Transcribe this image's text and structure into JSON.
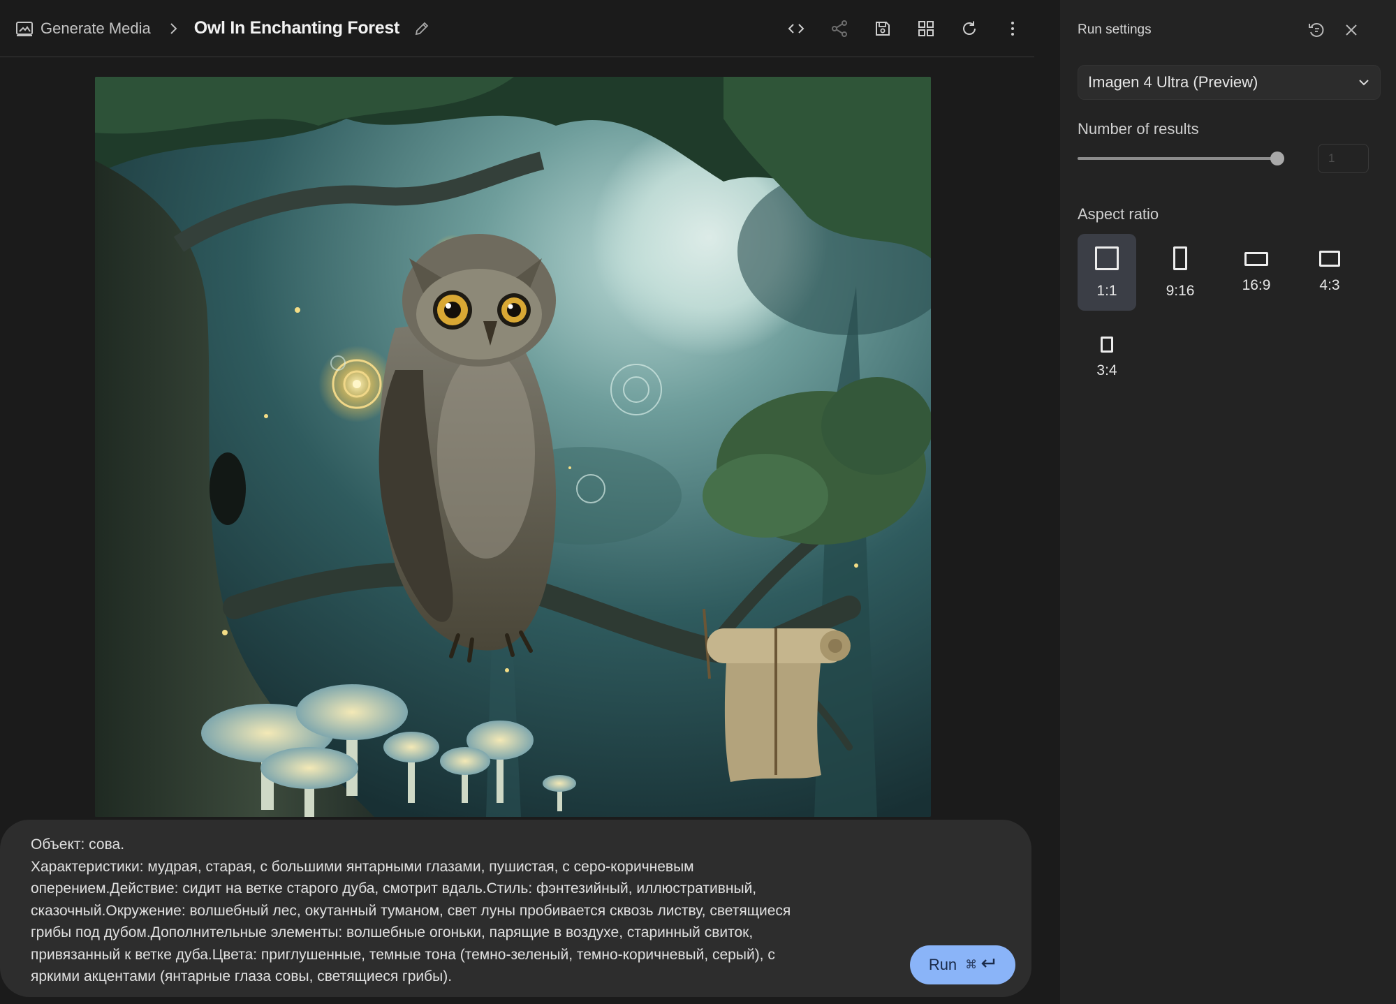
{
  "header": {
    "breadcrumb_parent": "Generate Media",
    "title": "Owl In Enchanting Forest",
    "icons": {
      "parent": "image-icon",
      "separator": "chevron-right-icon",
      "edit": "pencil-icon"
    },
    "toolbar": [
      "code-icon",
      "share-icon",
      "save-icon",
      "grid-icon",
      "refresh-icon",
      "more-vert-icon"
    ]
  },
  "prompt": {
    "text": "Объект: сова.\nХарактеристики: мудрая, старая, с большими янтарными глазами, пушистая, с серо-коричневым\nоперением.Действие: сидит на ветке старого дуба, смотрит вдаль.Стиль: фэнтезийный, иллюстративный,\nсказочный.Окружение: волшебный лес, окутанный туманом, свет луны пробивается сквозь листву, светящиеся\nгрибы под дубом.Дополнительные элементы: волшебные огоньки, парящие в воздухе, старинный свиток,\nпривязанный к ветке дуба.Цвета: приглушенные, темные тона (темно-зеленый, темно-коричневый, серый), с\nяркими акцентами (янтарные глаза совы, светящиеся грибы).",
    "run_label": "Run",
    "run_shortcut_icons": [
      "command-icon",
      "enter-icon"
    ],
    "run_color": "#8ab4f8"
  },
  "run_settings": {
    "title": "Run settings",
    "icons": [
      "reset-icon",
      "close-icon"
    ],
    "model": "Imagen 4 Ultra (Preview)",
    "number_of_results_label": "Number of results",
    "number_of_results_level": 1.0,
    "number_of_results_value": "1",
    "aspect_ratio_label": "Aspect ratio",
    "aspect_ratios": [
      {
        "label": "1:1",
        "selected": true
      },
      {
        "label": "9:16",
        "selected": false
      },
      {
        "label": "16:9",
        "selected": false
      },
      {
        "label": "4:3",
        "selected": false
      },
      {
        "label": "3:4",
        "selected": false
      }
    ]
  },
  "colors": {
    "background": "#1b1b1b",
    "panel": "#232323",
    "prompt_box": "#2d2d2d",
    "selected_ratio": "#3b3e46"
  }
}
